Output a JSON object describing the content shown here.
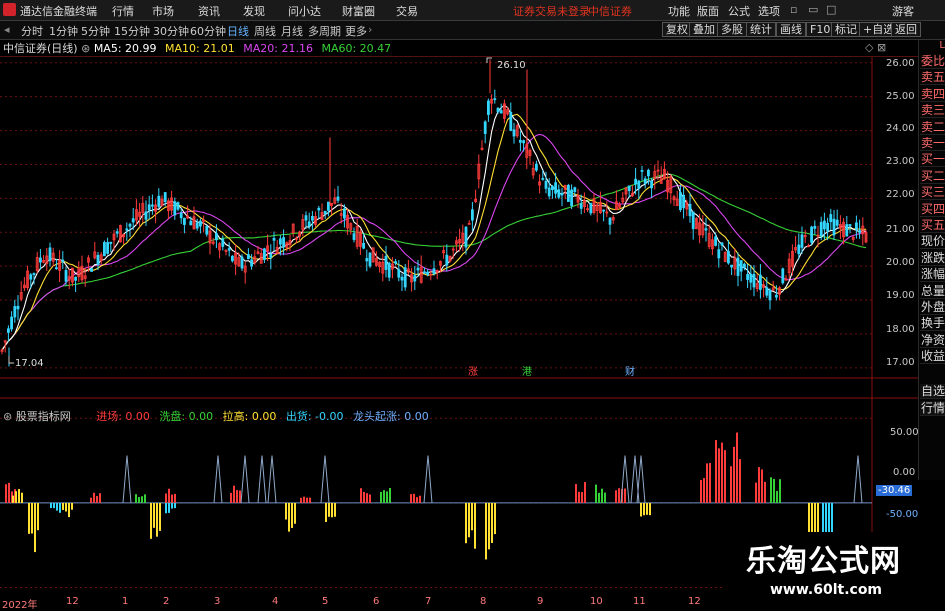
{
  "app": {
    "title": "通达信金融终端",
    "menu": [
      "行情",
      "市场",
      "资讯",
      "发现",
      "问小达",
      "财富圈",
      "交易"
    ],
    "warning": "证券交易未登录",
    "broker": "中信证券",
    "right_menu": [
      "功能",
      "版面",
      "公式",
      "选项"
    ],
    "user": "游客"
  },
  "toolbar": {
    "periods": [
      "分时",
      "1分钟",
      "5分钟",
      "15分钟",
      "30分钟",
      "60分钟",
      "日线",
      "周线",
      "月线",
      "多周期",
      "更多"
    ],
    "active_period": "日线",
    "right_buttons": [
      "复权",
      "叠加",
      "多股",
      "统计",
      "画线",
      "F10",
      "标记",
      "+自选",
      "返回"
    ]
  },
  "info": {
    "stock": "中信证券(日线)",
    "ma5_label": "MA5: 20.99",
    "ma10_label": "MA10: 21.01",
    "ma20_label": "MA20: 21.16",
    "ma60_label": "MA60: 20.47"
  },
  "right_panel": {
    "items": [
      "委比",
      "卖五",
      "卖四",
      "卖三",
      "卖二",
      "卖一",
      "买一",
      "买二",
      "买三",
      "买四",
      "买五",
      "现价",
      "涨跌",
      "涨幅",
      "总量",
      "外盘",
      "换手",
      "净资",
      "收益"
    ],
    "bottom_items": [
      "自选",
      "行情"
    ],
    "corner": "L"
  },
  "price_axis": [
    "26.00",
    "25.00",
    "24.00",
    "23.00",
    "22.00",
    "21.00",
    "20.00",
    "19.00",
    "18.00",
    "17.00"
  ],
  "annotations": {
    "high": "26.10",
    "low": "17.04",
    "markers": [
      "涨",
      "港",
      "财"
    ]
  },
  "indicator": {
    "name": "股票指标网",
    "items": [
      {
        "label": "进场: 0.00",
        "color": "#ff3b3b"
      },
      {
        "label": "洗盘: 0.00",
        "color": "#36d136"
      },
      {
        "label": "拉高: 0.00",
        "color": "#ffe033"
      },
      {
        "label": "出货: -0.00",
        "color": "#33d6ff"
      },
      {
        "label": "龙头起涨: 0.00",
        "color": "#6fb0ff"
      }
    ],
    "axis": [
      "50.00",
      "0.00",
      "-30.46",
      "-50.00"
    ]
  },
  "date_axis": [
    "2022年",
    "12",
    "1",
    "2",
    "3",
    "4",
    "5",
    "6",
    "7",
    "8",
    "9",
    "10",
    "11",
    "12"
  ],
  "watermark": {
    "title": "乐淘公式网",
    "url": "www.60lt.com"
  },
  "chart_data": {
    "type": "candlestick",
    "y_range": [
      16.7,
      26.2
    ],
    "high": 26.1,
    "low": 17.04,
    "ma_lines": [
      {
        "name": "MA5",
        "color": "#ffffff",
        "value": 20.99
      },
      {
        "name": "MA10",
        "color": "#ffe033",
        "value": 21.01
      },
      {
        "name": "MA20",
        "color": "#d946ef",
        "value": 21.16
      },
      {
        "name": "MA60",
        "color": "#36d136",
        "value": 20.47
      }
    ],
    "indicator_range": [
      -55,
      62
    ]
  }
}
